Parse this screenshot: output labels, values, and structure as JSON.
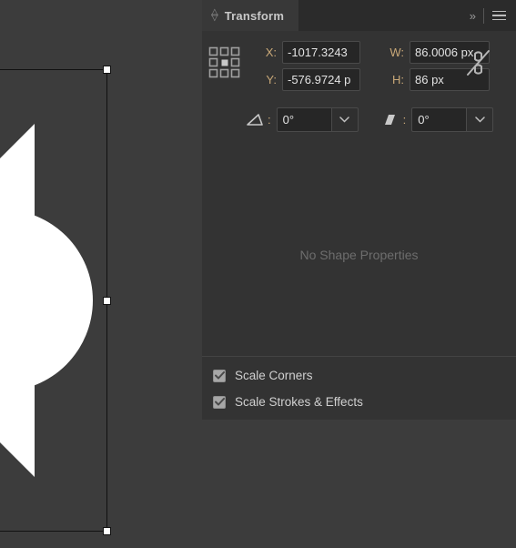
{
  "panel": {
    "tab_label": "Transform",
    "tab_arrows_icon": "updown-arrows-icon",
    "collapse_icon": "»",
    "menu_icon": "hamburger-menu-icon"
  },
  "transform": {
    "reference_point_icon": "reference-point-grid-icon",
    "x": {
      "label": "X:",
      "value": "-1017.3243"
    },
    "y": {
      "label": "Y:",
      "value": "-576.9724 p"
    },
    "w": {
      "label": "W:",
      "value": "86.0006 px"
    },
    "h": {
      "label": "H:",
      "value": "86 px"
    },
    "link_icon": "broken-chain-icon",
    "rotate": {
      "icon": "rotate-angle-icon",
      "label": ":",
      "value": "0°"
    },
    "shear": {
      "icon": "shear-angle-icon",
      "label": ":",
      "value": "0°"
    }
  },
  "shape_properties": {
    "empty_message": "No Shape Properties"
  },
  "options": [
    {
      "label": "Scale Corners",
      "checked": true
    },
    {
      "label": "Scale Strokes & Effects",
      "checked": true
    }
  ],
  "colors": {
    "panel_bg": "#333333",
    "header_bg": "#2b2b2b",
    "tab_bg": "#383838",
    "label_accent": "#c9a878",
    "field_bg": "#262626",
    "canvas_bg": "#3c3c3c",
    "artwork_fill": "#ffffff",
    "selection_stroke": "#111111"
  }
}
